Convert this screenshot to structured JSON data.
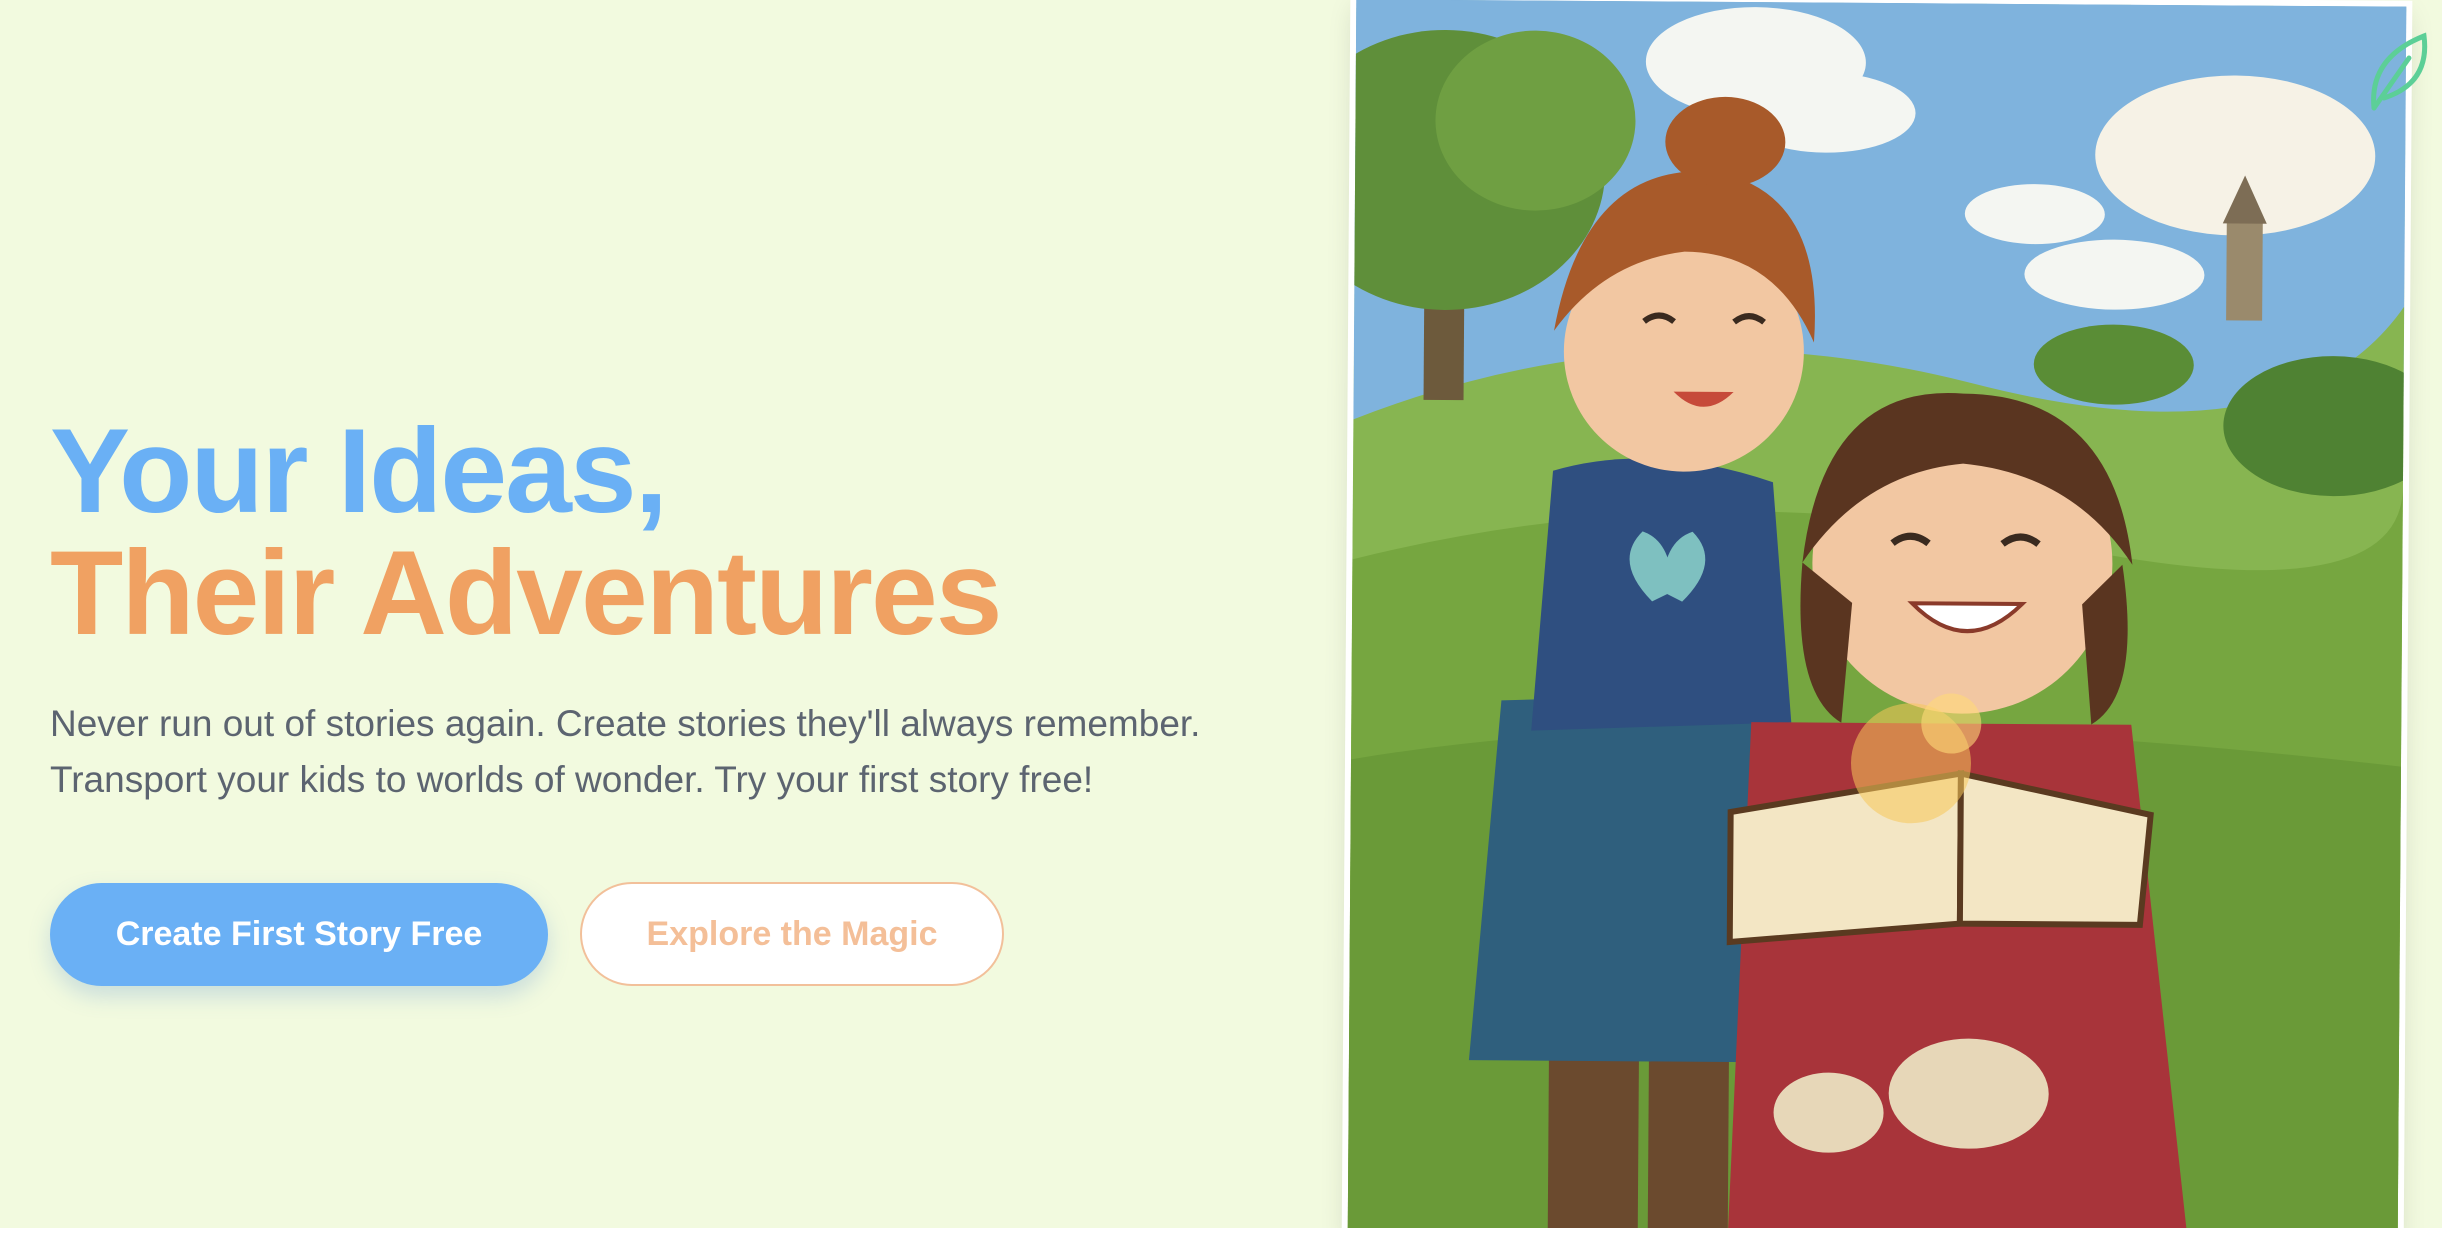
{
  "hero": {
    "headline_line1": "Your Ideas,",
    "headline_line2": "Their Adventures",
    "subtitle": "Never run out of stories again. Create stories they'll always remember. Transport your kids to worlds of wonder. Try your first story free!",
    "primary_cta": "Create First Story Free",
    "secondary_cta": "Explore the Magic"
  },
  "image": {
    "description_icon": "illustration-image",
    "alt": "Two smiling girls reading a glowing magic book in a meadow"
  },
  "icons": {
    "leaf": "leaf-icon"
  },
  "colors": {
    "background": "#f2fadf",
    "headline_blue": "#6ab0f5",
    "headline_orange": "#f0a162",
    "body_text": "#5c6470",
    "primary_button": "#6ab0f5",
    "secondary_button_text": "#f4bf98",
    "leaf_icon": "#5ccf97"
  }
}
